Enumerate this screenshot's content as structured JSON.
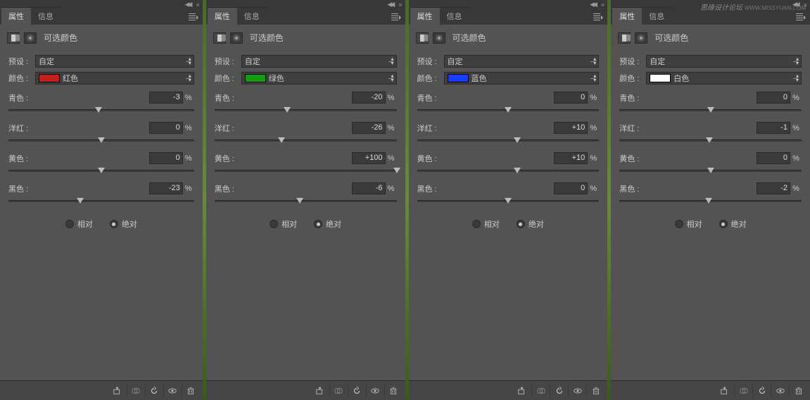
{
  "watermark": {
    "main": "思缘设计论坛",
    "sub": "WWW.MISSYUAN.COM"
  },
  "tabs": {
    "properties": "属性",
    "info": "信息"
  },
  "common": {
    "panel_title": "可选颜色",
    "preset_label": "预设 :",
    "preset_value": "自定",
    "color_label": "颜色 :",
    "unit": "%",
    "radio_relative": "相对",
    "radio_absolute": "绝对",
    "sliders": {
      "cyan": "青色 :",
      "magenta": "洋红 :",
      "yellow": "黄色 :",
      "black": "黑色 :"
    }
  },
  "panels": [
    {
      "color_name": "红色",
      "swatch": "#c21f1f",
      "values": {
        "cyan": "-3",
        "magenta": "0",
        "yellow": "0",
        "black": "-23"
      },
      "pos": {
        "cyan": 48.5,
        "magenta": 50,
        "yellow": 50,
        "black": 38.5
      }
    },
    {
      "color_name": "绿色",
      "swatch": "#169b16",
      "values": {
        "cyan": "-20",
        "magenta": "-26",
        "yellow": "+100",
        "black": "-6"
      },
      "pos": {
        "cyan": 40,
        "magenta": 37,
        "yellow": 100,
        "black": 47
      }
    },
    {
      "color_name": "蓝色",
      "swatch": "#1a3cff",
      "values": {
        "cyan": "0",
        "magenta": "+10",
        "yellow": "+10",
        "black": "0"
      },
      "pos": {
        "cyan": 50,
        "magenta": 55,
        "yellow": 55,
        "black": 50
      }
    },
    {
      "color_name": "白色",
      "swatch": "#ffffff",
      "values": {
        "cyan": "0",
        "magenta": "-1",
        "yellow": "0",
        "black": "-2"
      },
      "pos": {
        "cyan": 50,
        "magenta": 49.5,
        "yellow": 50,
        "black": 49
      }
    }
  ],
  "icons": {
    "clip": "↳",
    "link": "⟲",
    "reset": "↶",
    "eye": "👁",
    "trash": "🗑"
  }
}
